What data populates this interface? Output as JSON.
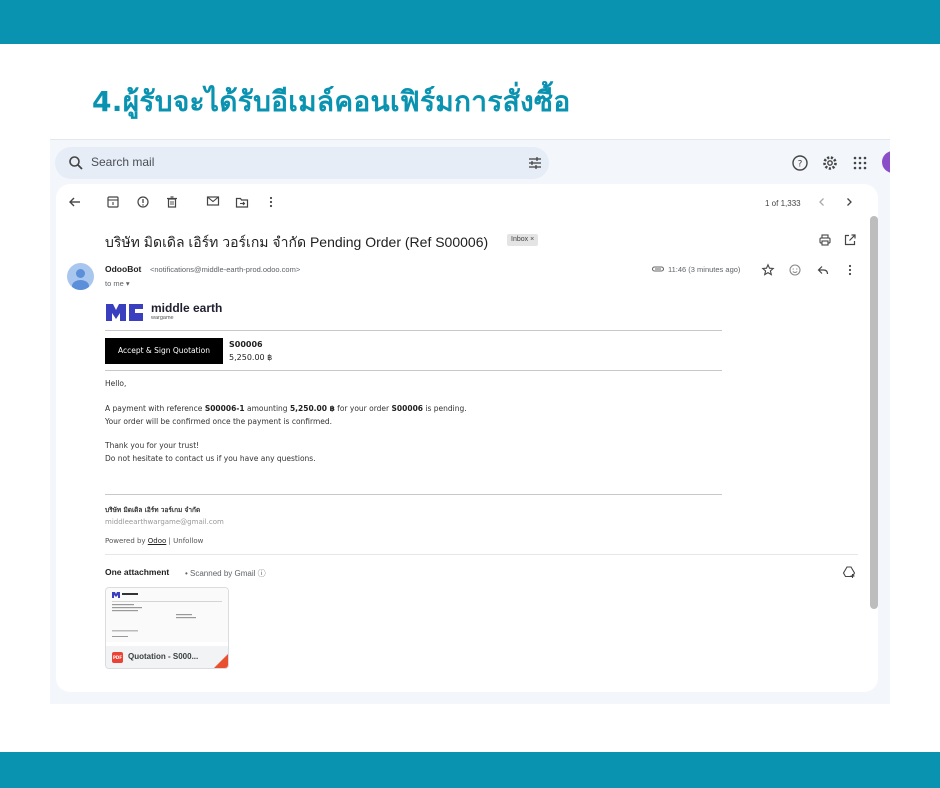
{
  "headline": "4.ผู้รับจะได้รับอีเมล์คอนเฟิร์มการสั่งซื้อ",
  "colors": {
    "band": "#0a93b0",
    "headline": "#0a93b0",
    "gmail_bg": "#f3f6fb"
  },
  "gmail": {
    "search_placeholder": "Search mail",
    "header_icons": [
      "help-icon",
      "settings-icon",
      "apps-icon"
    ],
    "toolbar_icons": [
      "back-arrow-icon",
      "archive-icon",
      "report-spam-icon",
      "delete-icon",
      "mark-unread-icon",
      "move-to-icon",
      "more-vertical-icon"
    ],
    "pager": "1 of 1,333",
    "subject": "บริษัท มิดเดิล เอิร์ท วอร์เกม จำกัด Pending Order (Ref S00006)",
    "label_badge": "Inbox ×",
    "sender_name": "OdooBot",
    "sender_email": "<notifications@middle-earth-prod.odoo.com>",
    "to_me": "to me ▾",
    "time": "11:46 (3 minutes ago)"
  },
  "email": {
    "logo_text": "middle earth",
    "logo_sub": "wargame",
    "accept_button": "Accept & Sign Quotation",
    "order_ref": "S00006",
    "order_amount": "5,250.00 ฿",
    "greeting": "Hello,",
    "payment_line_1a": "A payment with reference ",
    "payment_ref": "S00006-1",
    "payment_line_1b": " amounting ",
    "payment_amount": "5,250.00 ฿",
    "payment_line_1c": " for your order ",
    "payment_order": "S00006",
    "payment_line_1d": " is pending.",
    "payment_line_2": "Your order will be confirmed once the payment is confirmed.",
    "thanks_line_1": "Thank you for your trust!",
    "thanks_line_2": "Do not hesitate to contact us if you have any questions.",
    "signature_company": "บริษัท มิดเดิล เอิร์ท วอร์เกม จำกัด",
    "signature_email": "middleearthwargame@gmail.com",
    "powered_prefix": "Powered by ",
    "powered_link": "Odoo",
    "powered_sep": " | ",
    "unfollow": "Unfollow"
  },
  "attachments": {
    "title": "One attachment",
    "scanned": "• Scanned by Gmail ⓘ",
    "file_name": "Quotation - S000...",
    "file_type": "PDF"
  }
}
